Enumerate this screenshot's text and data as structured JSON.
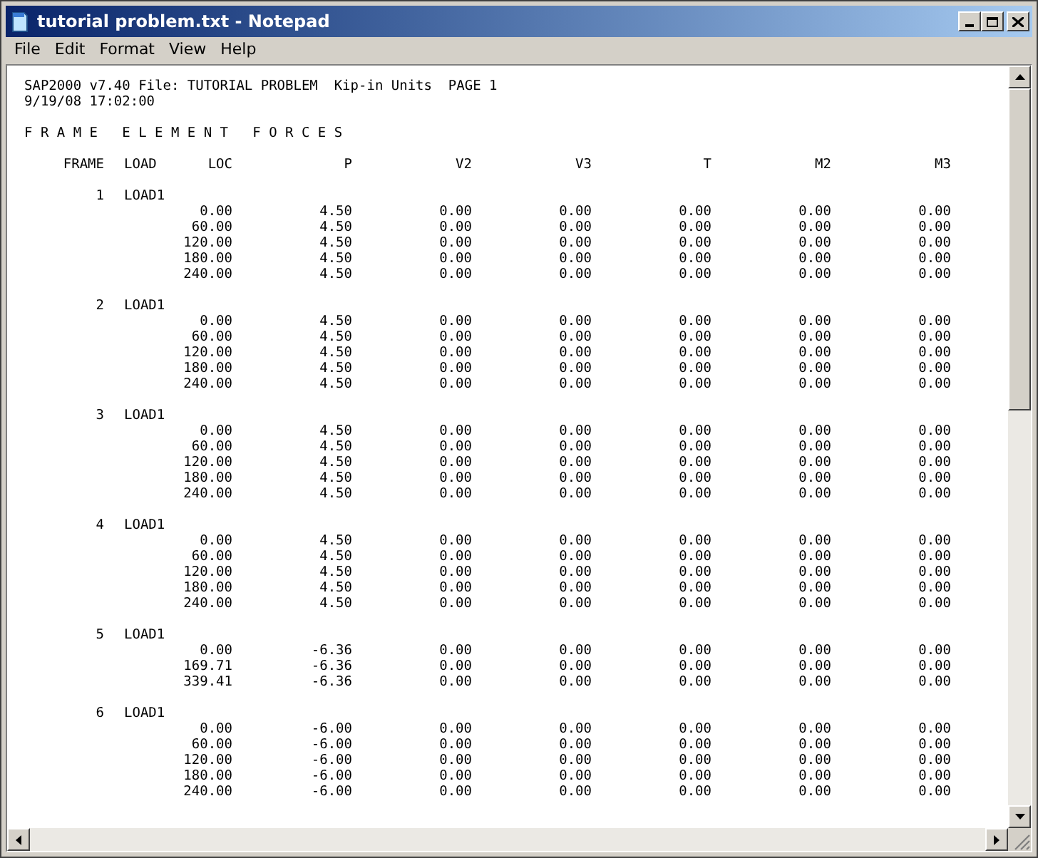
{
  "window": {
    "title": "tutorial problem.txt - Notepad"
  },
  "menu": [
    "File",
    "Edit",
    "Format",
    "View",
    "Help"
  ],
  "document": {
    "header_lines": [
      "SAP2000 v7.40 File: TUTORIAL PROBLEM  Kip-in Units  PAGE 1",
      "9/19/08 17:02:00"
    ],
    "section_title": "F R A M E   E L E M E N T   F O R C E S",
    "columns": [
      "FRAME",
      "LOAD",
      "LOC",
      "P",
      "V2",
      "V3",
      "T",
      "M2",
      "M3"
    ],
    "frames": [
      {
        "frame": "1",
        "load": "LOAD1",
        "rows": [
          [
            "0.00",
            "4.50",
            "0.00",
            "0.00",
            "0.00",
            "0.00",
            "0.00"
          ],
          [
            "60.00",
            "4.50",
            "0.00",
            "0.00",
            "0.00",
            "0.00",
            "0.00"
          ],
          [
            "120.00",
            "4.50",
            "0.00",
            "0.00",
            "0.00",
            "0.00",
            "0.00"
          ],
          [
            "180.00",
            "4.50",
            "0.00",
            "0.00",
            "0.00",
            "0.00",
            "0.00"
          ],
          [
            "240.00",
            "4.50",
            "0.00",
            "0.00",
            "0.00",
            "0.00",
            "0.00"
          ]
        ]
      },
      {
        "frame": "2",
        "load": "LOAD1",
        "rows": [
          [
            "0.00",
            "4.50",
            "0.00",
            "0.00",
            "0.00",
            "0.00",
            "0.00"
          ],
          [
            "60.00",
            "4.50",
            "0.00",
            "0.00",
            "0.00",
            "0.00",
            "0.00"
          ],
          [
            "120.00",
            "4.50",
            "0.00",
            "0.00",
            "0.00",
            "0.00",
            "0.00"
          ],
          [
            "180.00",
            "4.50",
            "0.00",
            "0.00",
            "0.00",
            "0.00",
            "0.00"
          ],
          [
            "240.00",
            "4.50",
            "0.00",
            "0.00",
            "0.00",
            "0.00",
            "0.00"
          ]
        ]
      },
      {
        "frame": "3",
        "load": "LOAD1",
        "rows": [
          [
            "0.00",
            "4.50",
            "0.00",
            "0.00",
            "0.00",
            "0.00",
            "0.00"
          ],
          [
            "60.00",
            "4.50",
            "0.00",
            "0.00",
            "0.00",
            "0.00",
            "0.00"
          ],
          [
            "120.00",
            "4.50",
            "0.00",
            "0.00",
            "0.00",
            "0.00",
            "0.00"
          ],
          [
            "180.00",
            "4.50",
            "0.00",
            "0.00",
            "0.00",
            "0.00",
            "0.00"
          ],
          [
            "240.00",
            "4.50",
            "0.00",
            "0.00",
            "0.00",
            "0.00",
            "0.00"
          ]
        ]
      },
      {
        "frame": "4",
        "load": "LOAD1",
        "rows": [
          [
            "0.00",
            "4.50",
            "0.00",
            "0.00",
            "0.00",
            "0.00",
            "0.00"
          ],
          [
            "60.00",
            "4.50",
            "0.00",
            "0.00",
            "0.00",
            "0.00",
            "0.00"
          ],
          [
            "120.00",
            "4.50",
            "0.00",
            "0.00",
            "0.00",
            "0.00",
            "0.00"
          ],
          [
            "180.00",
            "4.50",
            "0.00",
            "0.00",
            "0.00",
            "0.00",
            "0.00"
          ],
          [
            "240.00",
            "4.50",
            "0.00",
            "0.00",
            "0.00",
            "0.00",
            "0.00"
          ]
        ]
      },
      {
        "frame": "5",
        "load": "LOAD1",
        "rows": [
          [
            "0.00",
            "-6.36",
            "0.00",
            "0.00",
            "0.00",
            "0.00",
            "0.00"
          ],
          [
            "169.71",
            "-6.36",
            "0.00",
            "0.00",
            "0.00",
            "0.00",
            "0.00"
          ],
          [
            "339.41",
            "-6.36",
            "0.00",
            "0.00",
            "0.00",
            "0.00",
            "0.00"
          ]
        ]
      },
      {
        "frame": "6",
        "load": "LOAD1",
        "rows": [
          [
            "0.00",
            "-6.00",
            "0.00",
            "0.00",
            "0.00",
            "0.00",
            "0.00"
          ],
          [
            "60.00",
            "-6.00",
            "0.00",
            "0.00",
            "0.00",
            "0.00",
            "0.00"
          ],
          [
            "120.00",
            "-6.00",
            "0.00",
            "0.00",
            "0.00",
            "0.00",
            "0.00"
          ],
          [
            "180.00",
            "-6.00",
            "0.00",
            "0.00",
            "0.00",
            "0.00",
            "0.00"
          ],
          [
            "240.00",
            "-6.00",
            "0.00",
            "0.00",
            "0.00",
            "0.00",
            "0.00"
          ]
        ]
      }
    ]
  }
}
